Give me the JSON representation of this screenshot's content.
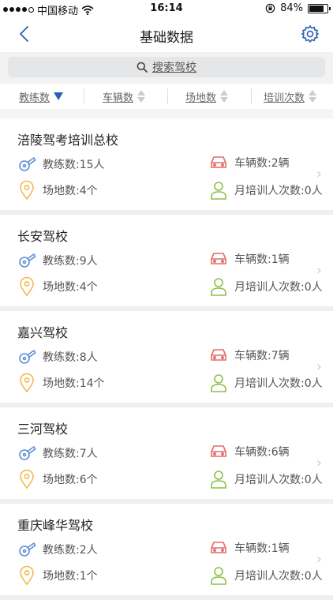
{
  "status_bar": {
    "carrier": "中国移动",
    "time": "16:14",
    "battery": "84%",
    "battery_level": 0.84
  },
  "nav": {
    "title": "基础数据"
  },
  "search": {
    "placeholder": "搜索驾校"
  },
  "sort": {
    "items": [
      {
        "label": "教练数",
        "active": true
      },
      {
        "label": "车辆数",
        "active": false
      },
      {
        "label": "场地数",
        "active": false
      },
      {
        "label": "培训次数",
        "active": false
      }
    ]
  },
  "colors": {
    "accent": "#2b5fb4",
    "coach_icon": "#5a8fd6",
    "car_icon": "#e46a6a",
    "site_icon": "#f0b94a",
    "trainee_icon": "#8cc04a"
  },
  "schools": [
    {
      "name": "涪陵驾考培训总校",
      "coaches": "教练数:15人",
      "vehicles": "车辆数:2辆",
      "sites": "场地数:4个",
      "monthly": "月培训人次数:0人"
    },
    {
      "name": "长安驾校",
      "coaches": "教练数:9人",
      "vehicles": "车辆数:1辆",
      "sites": "场地数:4个",
      "monthly": "月培训人次数:0人"
    },
    {
      "name": "嘉兴驾校",
      "coaches": "教练数:8人",
      "vehicles": "车辆数:7辆",
      "sites": "场地数:14个",
      "monthly": "月培训人次数:0人"
    },
    {
      "name": "三河驾校",
      "coaches": "教练数:7人",
      "vehicles": "车辆数:6辆",
      "sites": "场地数:6个",
      "monthly": "月培训人次数:0人"
    },
    {
      "name": "重庆峰华驾校",
      "coaches": "教练数:2人",
      "vehicles": "车辆数:1辆",
      "sites": "场地数:1个",
      "monthly": "月培训人次数:0人"
    }
  ]
}
